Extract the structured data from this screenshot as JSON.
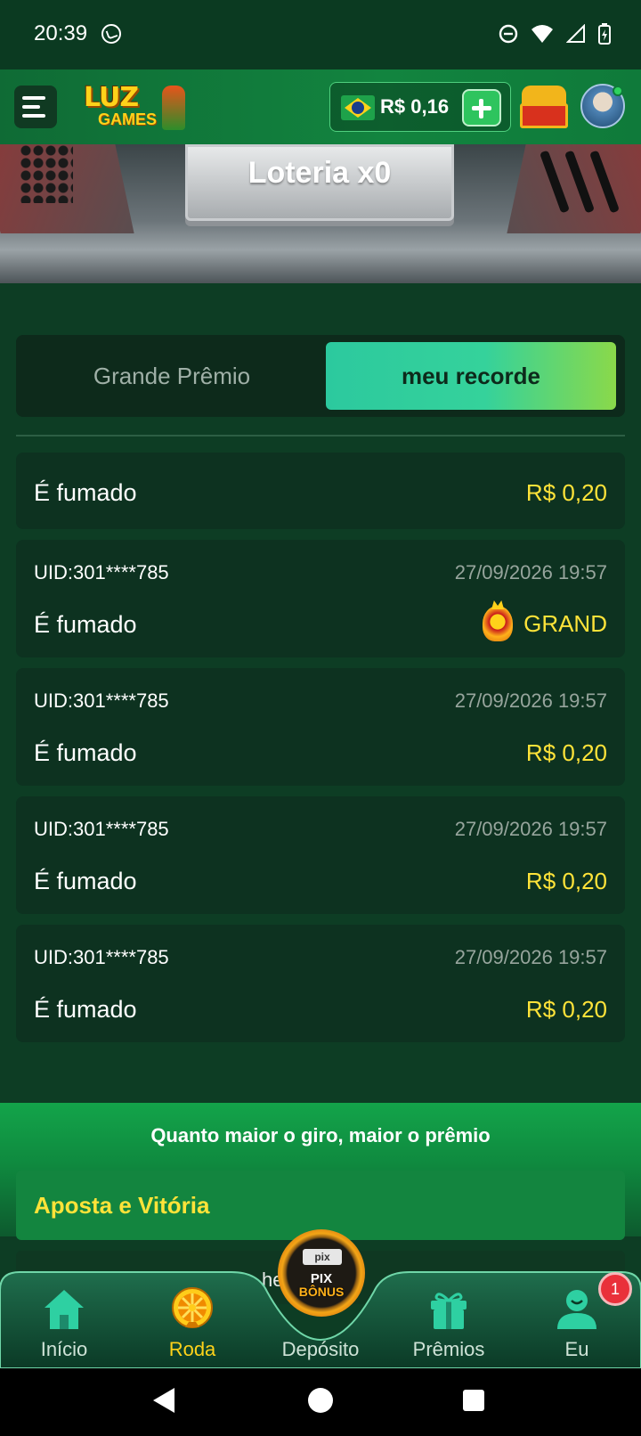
{
  "status_bar": {
    "time": "20:39"
  },
  "header": {
    "logo_word1": "LUZ",
    "logo_word2": "GAMES",
    "balance": "R$ 0,16"
  },
  "banner": {
    "title": "Loteria x0"
  },
  "tabs": [
    {
      "label": "Grande Prêmio",
      "active": false
    },
    {
      "label": "meu recorde",
      "active": true
    }
  ],
  "records": [
    {
      "uid": "",
      "date": "",
      "game": "É fumado",
      "value": "R$ 0,20"
    },
    {
      "uid": "UID:301****785",
      "date": "27/09/2026 19:57",
      "game": "É fumado",
      "value": "GRAND"
    },
    {
      "uid": "UID:301****785",
      "date": "27/09/2026 19:57",
      "game": "É fumado",
      "value": "R$ 0,20"
    },
    {
      "uid": "UID:301****785",
      "date": "27/09/2026 19:57",
      "game": "É fumado",
      "value": "R$ 0,20"
    },
    {
      "uid": "UID:301****785",
      "date": "27/09/2026 19:57",
      "game": "É fumado",
      "value": "R$ 0,20"
    }
  ],
  "promo": {
    "text": "Quanto maior o giro, maior o prêmio",
    "section_title": "Aposta e Vitória",
    "peek_text": "he  ch"
  },
  "pix_button": {
    "top": "pix",
    "label1": "PIX",
    "label2": "BÔNUS"
  },
  "bottom_nav": [
    {
      "label": "Início",
      "icon": "home-icon",
      "active": false
    },
    {
      "label": "Roda",
      "icon": "wheel-icon",
      "active": true
    },
    {
      "label": "Depósito",
      "icon": "deposit-icon",
      "active": false
    },
    {
      "label": "Prêmios",
      "icon": "gift-icon",
      "active": false
    },
    {
      "label": "Eu",
      "icon": "user-icon",
      "active": false
    }
  ],
  "badge_count": "1",
  "colors": {
    "accent_gold": "#ffe339",
    "brand_green": "#12843f",
    "tab_gradient_start": "#2cc99e",
    "tab_gradient_end": "#8ad94a"
  }
}
